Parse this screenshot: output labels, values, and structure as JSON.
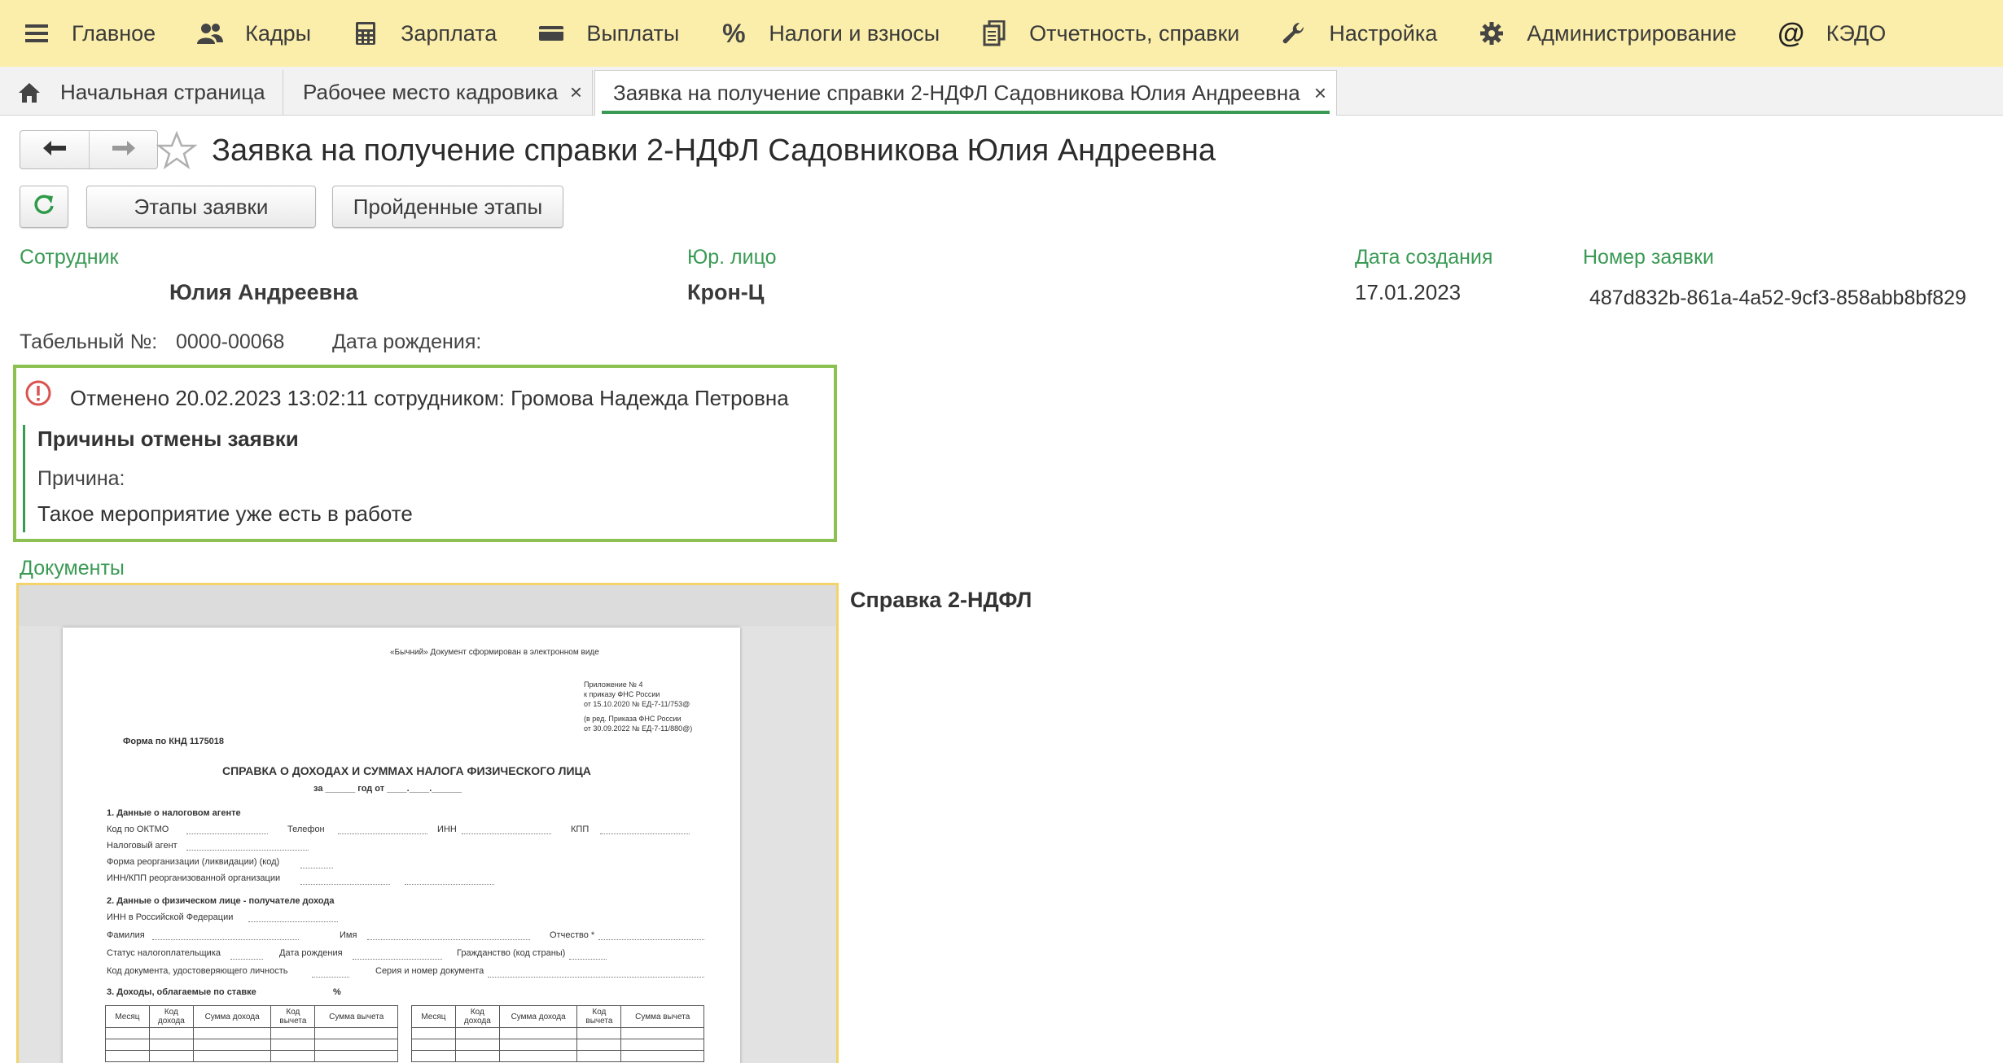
{
  "menu": [
    {
      "label": "Главное",
      "icon": "hamburger-icon"
    },
    {
      "label": "Кадры",
      "icon": "people-icon"
    },
    {
      "label": "Зарплата",
      "icon": "calculator-icon"
    },
    {
      "label": "Выплаты",
      "icon": "wallet-icon"
    },
    {
      "label": "Налоги и взносы",
      "icon": "percent-icon"
    },
    {
      "label": "Отчетность, справки",
      "icon": "documents-icon"
    },
    {
      "label": "Настройка",
      "icon": "wrench-icon"
    },
    {
      "label": "Администрирование",
      "icon": "gear-icon"
    },
    {
      "label": "КЭДО",
      "icon": "at-icon"
    }
  ],
  "tabs": [
    {
      "label": "Начальная страница",
      "icon": "home-icon",
      "active": false
    },
    {
      "label": "Рабочее место кадровика",
      "close": "×",
      "active": false
    },
    {
      "label": "Заявка на получение справки 2-НДФЛ Садовникова Юлия Андреевна",
      "close": "×",
      "active": true
    }
  ],
  "page": {
    "title": "Заявка на получение справки 2-НДФЛ Садовникова Юлия Андреевна"
  },
  "toolbar": {
    "stages_label": "Этапы заявки",
    "passed_label": "Пройденные этапы"
  },
  "fields": {
    "employee_label": "Сотрудник",
    "employee_value": "Юлия Андреевна",
    "legal_label": "Юр. лицо",
    "legal_value": "Крон-Ц",
    "created_label": "Дата создания",
    "created_value": "17.01.2023",
    "number_label": "Номер заявки",
    "number_value": "487d832b-861a-4a52-9cf3-858abb8bf829",
    "tab_no_label": "Табельный №:",
    "tab_no_value": "0000-00068",
    "birth_label": "Дата рождения:"
  },
  "cancel": {
    "status": "Отменено 20.02.2023 13:02:11 сотрудником: Громова Надежда Петровна",
    "reasons_title": "Причины отмены заявки",
    "reason_label": "Причина:",
    "reason_text": "Такое мероприятие уже есть в работе"
  },
  "documents": {
    "label": "Документы",
    "caption": "Справка 2-НДФЛ",
    "preview": {
      "stamp": "«Бычний» Документ сформирован в электронном виде",
      "appendix": [
        "Приложение № 4",
        "к приказу ФНС России",
        "от 15.10.2020 № ЕД-7-11/753@",
        "(в ред. Приказа ФНС России",
        "от 30.09.2022 № ЕД-7-11/880@)"
      ],
      "form_code": "Форма по КНД 1175018",
      "title": "СПРАВКА О ДОХОДАХ И СУММАХ НАЛОГА ФИЗИЧЕСКОГО ЛИЦА",
      "period": "за ______ год   от ____.____.______",
      "s1": "1. Данные о налоговом агенте",
      "s1_fields": [
        "Код по ОКТМО",
        "Телефон",
        "ИНН",
        "КПП",
        "Налоговый агент",
        "Форма реорганизации (ликвидации) (код)",
        "ИНН/КПП реорганизованной организации"
      ],
      "s2": "2. Данные о физическом лице - получателе дохода",
      "s2_fields": [
        "ИНН в Российской Федерации",
        "Фамилия",
        "Имя",
        "Отчество *",
        "Статус налогоплательщика",
        "Дата рождения",
        "Гражданство (код страны)",
        "Код документа, удостоверяющего личность",
        "Серия и номер документа"
      ],
      "s3": "3. Доходы, облагаемые по ставке",
      "s3_pct": "%",
      "table_headers": [
        "Месяц",
        "Код дохода",
        "Сумма дохода",
        "Код вычета",
        "Сумма вычета"
      ]
    }
  }
}
